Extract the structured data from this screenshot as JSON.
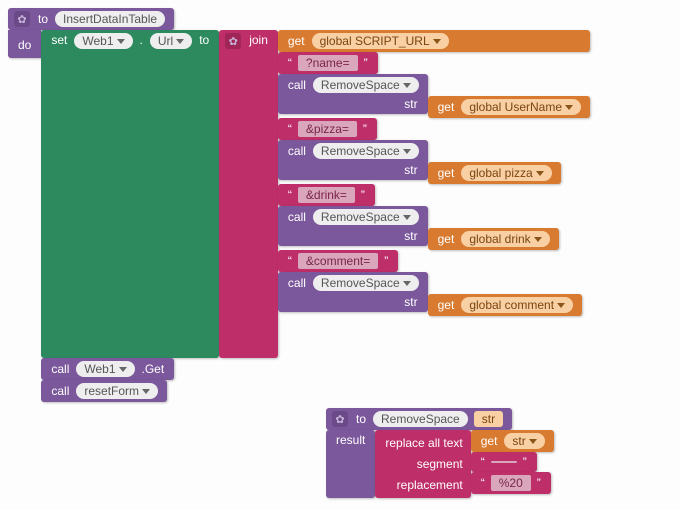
{
  "proc1": {
    "to": "to",
    "name": "InsertDataInTable",
    "do": "do",
    "set": "set",
    "web1": "Web1",
    "dot": ".",
    "url": "Url",
    "toWord": "to",
    "join": "join",
    "get": "get",
    "gScript": "global SCRIPT_URL",
    "qName": "?name=",
    "call": "call",
    "removeSpace": "RemoveSpace",
    "strLbl": "str",
    "gUser": "global UserName",
    "qPizza": "&pizza=",
    "gPizza": "global pizza",
    "qDrink": "&drink=",
    "gDrink": "global drink",
    "qComment": "&comment=",
    "gComment": "global comment",
    "webGet": ".Get",
    "resetForm": "resetForm"
  },
  "proc2": {
    "to": "to",
    "name": "RemoveSpace",
    "param": "str",
    "result": "result",
    "replace": "replace all text",
    "get": "get",
    "strVar": "str",
    "segment": "segment",
    "space": " ",
    "replacement": "replacement",
    "enc": "%20"
  }
}
